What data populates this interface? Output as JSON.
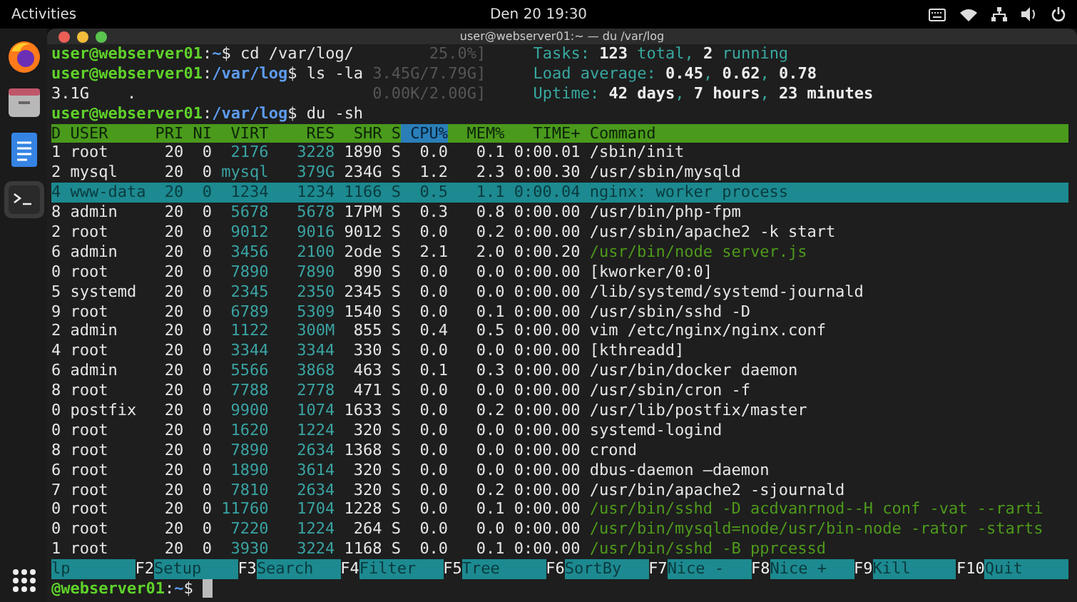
{
  "top_bar": {
    "activities": "Activities",
    "clock": "Den 20  19:30"
  },
  "window": {
    "title": "user@webserver01:~ — du /var/log"
  },
  "top_lines": [
    {
      "prompt": {
        "user_host": "user@webserver01",
        "sep": ":",
        "path": "~",
        "command": "$ cd /var/log/"
      },
      "meter": "25.0%]",
      "info": "Tasks: **123** total, **2** running"
    },
    {
      "prompt": {
        "user_host": "user@webserver01",
        "sep": ":",
        "path": "/var/log",
        "command": "$ ls -la"
      },
      "meter": "3.45G/7.79G]",
      "info": "Load average: **0.45**, **0.62**, **0.78**"
    },
    {
      "output": "3.1G    .",
      "meter": "0.00K/2.00G]",
      "info": "Uptime: **42 days**, **7 hours**, **23 minutes**"
    },
    {
      "prompt": {
        "user_host": "user@webserver01",
        "sep": ":",
        "path": "/var/log",
        "command": "$ du -sh"
      }
    }
  ],
  "processes": {
    "columns": [
      {
        "label": "D",
        "sorted": false
      },
      {
        "label": "USER",
        "sorted": false
      },
      {
        "label": "PRI",
        "sorted": false
      },
      {
        "label": "NI",
        "sorted": false
      },
      {
        "label": "VIRT",
        "sorted": false
      },
      {
        "label": "RES",
        "sorted": false
      },
      {
        "label": "SHR",
        "sorted": false
      },
      {
        "label": "S",
        "sorted": false
      },
      {
        "label": "CPU%",
        "sorted": true
      },
      {
        "label": "MEM%",
        "sorted": false
      },
      {
        "label": "TIME+",
        "sorted": false
      },
      {
        "label": "Command",
        "sorted": false
      }
    ],
    "rows": [
      {
        "pid": "1",
        "user": "root",
        "pri": "20",
        "ni": "0",
        "virt": "2176",
        "res": "3228",
        "shr": "1890",
        "state": "S",
        "cpu": "0.0",
        "mem": "0.1",
        "time": "0:00.01",
        "command": "/sbin/init",
        "kind": "process",
        "selected": false
      },
      {
        "pid": "2",
        "user": "mysql",
        "pri": "20",
        "ni": "0",
        "virt": "mysql",
        "res": "379G",
        "shr": "234G",
        "state": "S",
        "cpu": "1.2",
        "mem": "2.3",
        "time": "0:00.30",
        "command": "/usr/sbin/mysqld",
        "kind": "process",
        "selected": false
      },
      {
        "pid": "4",
        "user": "www-data",
        "pri": "20",
        "ni": "0",
        "virt": "1234",
        "res": "1234",
        "shr": "1166",
        "state": "S",
        "cpu": "0.5",
        "mem": "1.1",
        "time": "0:00.04",
        "command": "nginx: worker process",
        "kind": "process",
        "selected": true
      },
      {
        "pid": "8",
        "user": "admin",
        "pri": "20",
        "ni": "0",
        "virt": "5678",
        "res": "5678",
        "shr": "17PM",
        "state": "S",
        "cpu": "0.3",
        "mem": "0.8",
        "time": "0:00.00",
        "command": "/usr/bin/php-fpm",
        "kind": "process",
        "selected": false
      },
      {
        "pid": "2",
        "user": "root",
        "pri": "20",
        "ni": "0",
        "virt": "9012",
        "res": "9016",
        "shr": "9012",
        "state": "S",
        "cpu": "0.0",
        "mem": "0.2",
        "time": "0:00.00",
        "command": "/usr/sbin/apache2 -k start",
        "kind": "process",
        "selected": false
      },
      {
        "pid": "6",
        "user": "admin",
        "pri": "20",
        "ni": "0",
        "virt": "3456",
        "res": "2100",
        "shr": "2ode",
        "state": "S",
        "cpu": "2.1",
        "mem": "2.0",
        "time": "0:00.20",
        "command": "/usr/bin/node server.js",
        "kind": "thread",
        "selected": false
      },
      {
        "pid": "0",
        "user": "root",
        "pri": "20",
        "ni": "0",
        "virt": "7890",
        "res": "7890",
        "shr": "890",
        "state": "S",
        "cpu": "0.0",
        "mem": "0.0",
        "time": "0:00.00",
        "command": "[kworker/0:0]",
        "kind": "process",
        "selected": false
      },
      {
        "pid": "5",
        "user": "systemd",
        "pri": "20",
        "ni": "0",
        "virt": "2345",
        "res": "2350",
        "shr": "2345",
        "state": "S",
        "cpu": "0.0",
        "mem": "0.0",
        "time": "0:00.00",
        "command": "/lib/systemd/systemd-journald",
        "kind": "process",
        "selected": false
      },
      {
        "pid": "9",
        "user": "root",
        "pri": "20",
        "ni": "0",
        "virt": "6789",
        "res": "5309",
        "shr": "1540",
        "state": "S",
        "cpu": "0.0",
        "mem": "0.1",
        "time": "0:00.00",
        "command": "/usr/sbin/sshd -D",
        "kind": "process",
        "selected": false
      },
      {
        "pid": "2",
        "user": "admin",
        "pri": "20",
        "ni": "0",
        "virt": "1122",
        "res": "300M",
        "shr": "855",
        "state": "S",
        "cpu": "0.4",
        "mem": "0.5",
        "time": "0:00.00",
        "command": "vim /etc/nginx/nginx.conf",
        "kind": "process",
        "selected": false
      },
      {
        "pid": "4",
        "user": "root",
        "pri": "20",
        "ni": "0",
        "virt": "3344",
        "res": "3344",
        "shr": "330",
        "state": "S",
        "cpu": "0.0",
        "mem": "0.0",
        "time": "0:00.00",
        "command": "[kthreadd]",
        "kind": "process",
        "selected": false
      },
      {
        "pid": "6",
        "user": "admin",
        "pri": "20",
        "ni": "0",
        "virt": "5566",
        "res": "3868",
        "shr": "463",
        "state": "S",
        "cpu": "0.1",
        "mem": "0.3",
        "time": "0:00.00",
        "command": "/usr/bin/docker daemon",
        "kind": "process",
        "selected": false
      },
      {
        "pid": "8",
        "user": "root",
        "pri": "20",
        "ni": "0",
        "virt": "7788",
        "res": "2778",
        "shr": "471",
        "state": "S",
        "cpu": "0.0",
        "mem": "0.0",
        "time": "0:00.00",
        "command": "/usr/sbin/cron -f",
        "kind": "process",
        "selected": false
      },
      {
        "pid": "0",
        "user": "postfix",
        "pri": "20",
        "ni": "0",
        "virt": "9900",
        "res": "1074",
        "shr": "1633",
        "state": "S",
        "cpu": "0.0",
        "mem": "0.2",
        "time": "0:00.00",
        "command": "/usr/lib/postfix/master",
        "kind": "process",
        "selected": false
      },
      {
        "pid": "0",
        "user": "root",
        "pri": "20",
        "ni": "0",
        "virt": "1620",
        "res": "1224",
        "shr": "320",
        "state": "S",
        "cpu": "0.0",
        "mem": "0.0",
        "time": "0:00.00",
        "command": "systemd-logind",
        "kind": "process",
        "selected": false
      },
      {
        "pid": "8",
        "user": "root",
        "pri": "20",
        "ni": "0",
        "virt": "7890",
        "res": "2634",
        "shr": "1368",
        "state": "S",
        "cpu": "0.0",
        "mem": "0.0",
        "time": "0:00.00",
        "command": "crond",
        "kind": "process",
        "selected": false
      },
      {
        "pid": "6",
        "user": "root",
        "pri": "20",
        "ni": "0",
        "virt": "1890",
        "res": "3614",
        "shr": "320",
        "state": "S",
        "cpu": "0.0",
        "mem": "0.0",
        "time": "0:00.00",
        "command": "dbus-daemon —daemon",
        "kind": "process",
        "selected": false
      },
      {
        "pid": "7",
        "user": "root",
        "pri": "20",
        "ni": "0",
        "virt": "7810",
        "res": "2634",
        "shr": "320",
        "state": "S",
        "cpu": "0.0",
        "mem": "0.2",
        "time": "0:00.00",
        "command": "/usr/bin/apache2 -sjournald",
        "kind": "process",
        "selected": false
      },
      {
        "pid": "0",
        "user": "root",
        "pri": "20",
        "ni": "0",
        "virt": "11760",
        "res": "1704",
        "shr": "1228",
        "state": "S",
        "cpu": "0.0",
        "mem": "0.1",
        "time": "0:00.00",
        "command": "/usr/bin/sshd -D acdvanrnod--H conf -vat --rarti",
        "kind": "thread",
        "selected": false
      },
      {
        "pid": "0",
        "user": "root",
        "pri": "20",
        "ni": "0",
        "virt": "7220",
        "res": "1224",
        "shr": "264",
        "state": "S",
        "cpu": "0.0",
        "mem": "0.0",
        "time": "0:00.00",
        "command": "/usr/bin/mysqld=node/usr/bin-node -rator -starts",
        "kind": "thread",
        "selected": false
      },
      {
        "pid": "1",
        "user": "root",
        "pri": "20",
        "ni": "0",
        "virt": "3930",
        "res": "3224",
        "shr": "1168",
        "state": "S",
        "cpu": "0.0",
        "mem": "0.1",
        "time": "0:00.00",
        "command": "/usr/bin/sshd -B pprcessd",
        "kind": "thread",
        "selected": false
      }
    ]
  },
  "function_keys": [
    {
      "label": "lp"
    },
    {
      "key": "F2",
      "label": "Setup"
    },
    {
      "key": "F3",
      "label": "Search"
    },
    {
      "key": "F4",
      "label": "Filter"
    },
    {
      "key": "F5",
      "label": "Tree"
    },
    {
      "key": "F6",
      "label": "SortBy"
    },
    {
      "key": "F7",
      "label": "Nice -"
    },
    {
      "key": "F8",
      "label": "Nice +"
    },
    {
      "key": "F9",
      "label": "Kill"
    },
    {
      "key": "F10",
      "label": "Quit"
    }
  ],
  "bottom_prompt": {
    "user_host": "@webserver01",
    "sep": ":",
    "path": "~",
    "command": "$"
  }
}
